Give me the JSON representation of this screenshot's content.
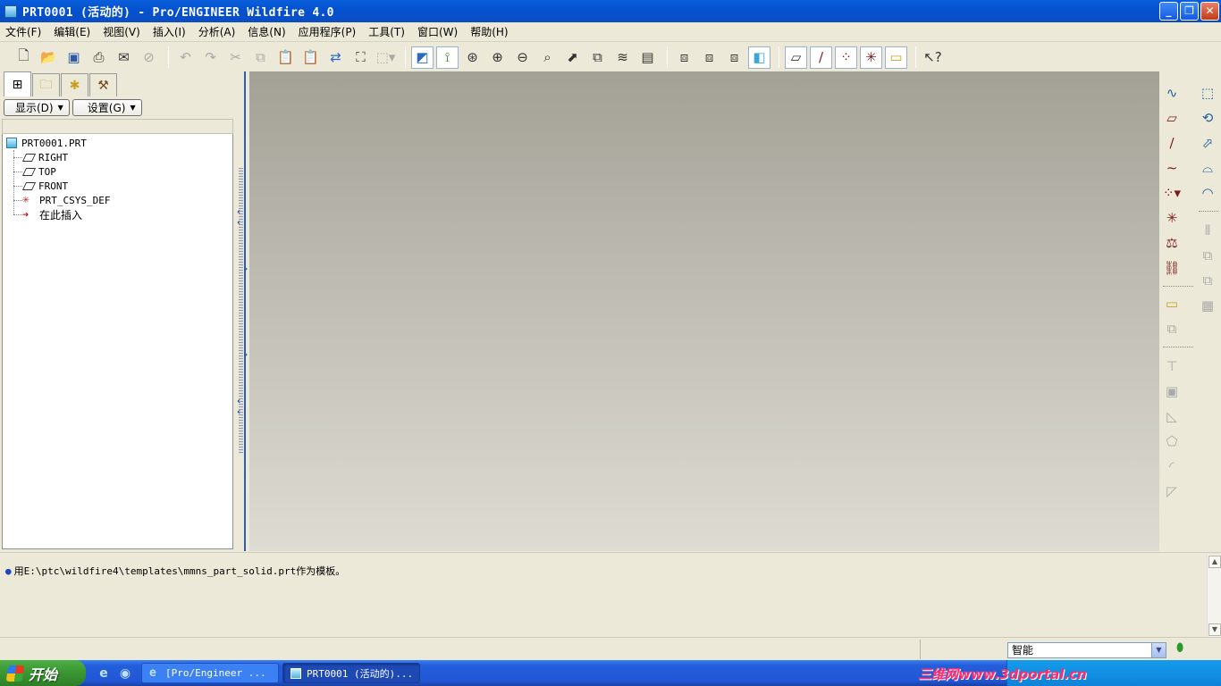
{
  "window": {
    "title": "PRT0001 (活动的) - Pro/ENGINEER Wildfire 4.0",
    "min_label": "_",
    "max_label": "❐",
    "close_label": "✕"
  },
  "menu": [
    "文件(F)",
    "编辑(E)",
    "视图(V)",
    "插入(I)",
    "分析(A)",
    "信息(N)",
    "应用程序(P)",
    "工具(T)",
    "窗口(W)",
    "帮助(H)"
  ],
  "nav": {
    "show_label": "显示(D)",
    "settings_label": "设置(G)",
    "tree": {
      "root": "PRT0001.PRT",
      "items": [
        "RIGHT",
        "TOP",
        "FRONT",
        "PRT_CSYS_DEF",
        "在此插入"
      ]
    }
  },
  "message": {
    "text": "用E:\\ptc\\wildfire4\\templates\\mmns_part_solid.prt作为模板。"
  },
  "status": {
    "filter_value": "智能"
  },
  "taskbar": {
    "start_label": "开始",
    "tasks": [
      "[Pro/Engineer ...",
      "PRT0001 (活动的)..."
    ],
    "watermark": "三维网www.3dportal.cn"
  },
  "colors": {
    "viewport_top": "#a3a196",
    "viewport_bottom": "#dddcd3",
    "title_blue": "#0a5fdc",
    "panel_bg": "#ece9d8"
  },
  "icons": {
    "toolbar_main": [
      "new-file-icon",
      "open-icon",
      "save-icon",
      "print-icon",
      "send-mail-icon",
      "erase-icon",
      "undo-icon",
      "redo-icon",
      "cut-icon",
      "copy-icon",
      "paste-icon",
      "paste-special-icon",
      "regenerate-icon",
      "find-icon",
      "select-box-icon",
      "repaint-icon",
      "spin-center-icon",
      "orient-mode-icon",
      "zoom-in-icon",
      "zoom-out-icon",
      "refit-icon",
      "reorient-icon",
      "saved-views-icon",
      "layers-icon",
      "view-manager-icon",
      "wireframe-icon",
      "hidden-line-icon",
      "no-hidden-icon",
      "shading-icon",
      "datum-planes-toggle-icon",
      "datum-axes-toggle-icon",
      "datum-points-toggle-icon",
      "csys-toggle-icon",
      "annotations-toggle-icon",
      "context-help-icon"
    ]
  }
}
